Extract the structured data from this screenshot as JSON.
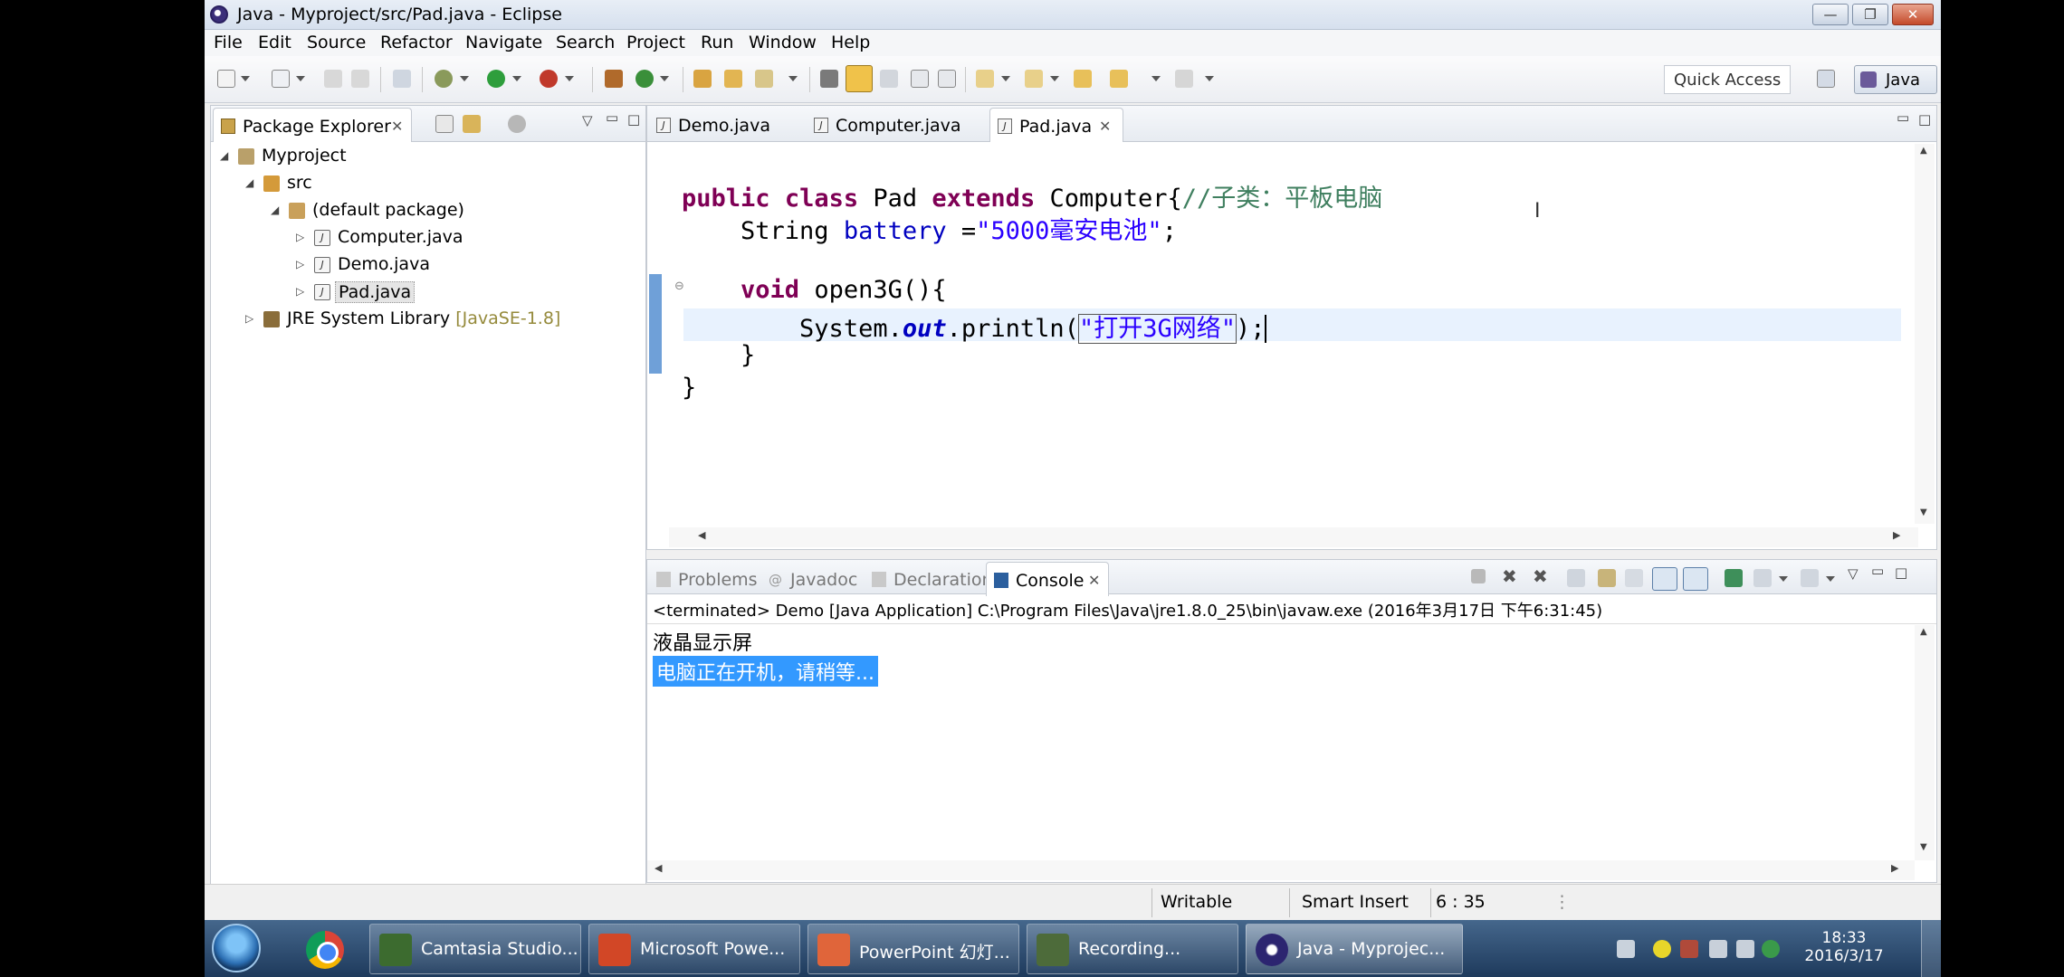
{
  "window": {
    "title": "Java - Myproject/src/Pad.java - Eclipse",
    "minimize_glyph": "—",
    "restore_glyph": "❐",
    "close_glyph": "✕"
  },
  "menu": [
    "File",
    "Edit",
    "Source",
    "Refactor",
    "Navigate",
    "Search",
    "Project",
    "Run",
    "Window",
    "Help"
  ],
  "toolbar": {
    "quick_access": "Quick Access",
    "perspective": "Java"
  },
  "package_explorer": {
    "tab_label": "Package Explorer",
    "tree": [
      {
        "label": "Myproject",
        "icon": "project-icon"
      },
      {
        "label": "src",
        "icon": "source-folder-icon"
      },
      {
        "label": "(default package)",
        "icon": "package-icon"
      },
      {
        "label": "Computer.java",
        "icon": "java-file-icon"
      },
      {
        "label": "Demo.java",
        "icon": "java-file-icon"
      },
      {
        "label": "Pad.java",
        "icon": "java-file-icon"
      },
      {
        "label": "JRE System Library",
        "suffix": "[JavaSE-1.8]",
        "icon": "library-icon"
      }
    ]
  },
  "editor": {
    "tabs": [
      "Demo.java",
      "Computer.java",
      "Pad.java"
    ],
    "active_tab": "Pad.java",
    "code": {
      "l1_kw1": "public",
      "l1_kw2": "class",
      "l1_name": "Pad",
      "l1_kw3": "extends",
      "l1_super": "Computer{",
      "l1_comment": "//子类：平板电脑",
      "l2_type": "String",
      "l2_field": "battery",
      "l2_eq": " =",
      "l2_str": "\"5000毫安电池\"",
      "l2_end": ";",
      "l3_kw": "void",
      "l3_rest": "open3G(){",
      "l4_sys": "System.",
      "l4_out": "out",
      "l4_call": ".println(",
      "l4_str": "\"打开3G网络\"",
      "l4_end": ");",
      "l5": "}",
      "l6": "}"
    }
  },
  "bottom_panel": {
    "tabs": [
      "Problems",
      "Javadoc",
      "Declaration",
      "Console"
    ],
    "active_tab": "Console",
    "console_header": "<terminated> Demo [Java Application] C:\\Program Files\\Java\\jre1.8.0_25\\bin\\javaw.exe (2016年3月17日 下午6:31:45)",
    "output": [
      "液晶显示屏",
      "电脑正在开机，请稍等..."
    ]
  },
  "status": {
    "mode": "Writable",
    "insert": "Smart Insert",
    "position": "6 : 35"
  },
  "taskbar": {
    "items": [
      {
        "label": "Camtasia Studio..."
      },
      {
        "label": "Microsoft Powe..."
      },
      {
        "label": "PowerPoint 幻灯..."
      },
      {
        "label": "Recording..."
      },
      {
        "label": "Java - Myprojec..."
      }
    ],
    "time": "18:33",
    "date": "2016/3/17"
  },
  "colors": {
    "keyword": "#7f0055",
    "string": "#2a00ff",
    "comment": "#3f7f5f",
    "field": "#0000c0",
    "selection": "#3399ff"
  }
}
